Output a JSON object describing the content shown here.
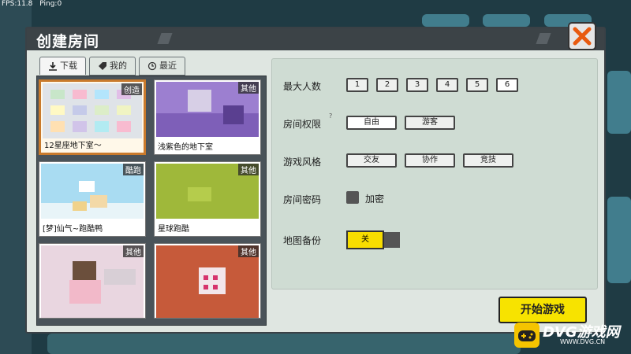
{
  "hud": {
    "fps": "FPS:11.8",
    "ping": "Ping:0"
  },
  "dialog": {
    "title": "创建房间",
    "tabs": [
      {
        "label": "下载",
        "icon": "download-icon"
      },
      {
        "label": "我的",
        "icon": "tag-icon"
      },
      {
        "label": "最近",
        "icon": "clock-icon"
      }
    ],
    "maps": [
      {
        "name": "12星座地下室～",
        "tag": "创造"
      },
      {
        "name": "浅紫色的地下室",
        "tag": "其他"
      },
      {
        "name": "[梦]仙气~跑酷鸭",
        "tag": "酷跑"
      },
      {
        "name": "星球跑酷",
        "tag": "其他"
      },
      {
        "name": "",
        "tag": "其他"
      },
      {
        "name": "",
        "tag": "其他"
      }
    ],
    "settings": {
      "max_players_label": "最大人数",
      "player_options": [
        "1",
        "2",
        "3",
        "4",
        "5",
        "6"
      ],
      "selected_players": "6",
      "permission_label": "房间权限",
      "permission_options": [
        "自由",
        "游客"
      ],
      "style_label": "游戏风格",
      "style_options": [
        "交友",
        "协作",
        "竞技"
      ],
      "password_label": "房间密码",
      "password_option": "加密",
      "backup_label": "地图备份",
      "backup_value": "关"
    },
    "start_button": "开始游戏"
  },
  "watermark": {
    "brand": "DVG游戏网",
    "url": "WWW.DVG.CN"
  }
}
